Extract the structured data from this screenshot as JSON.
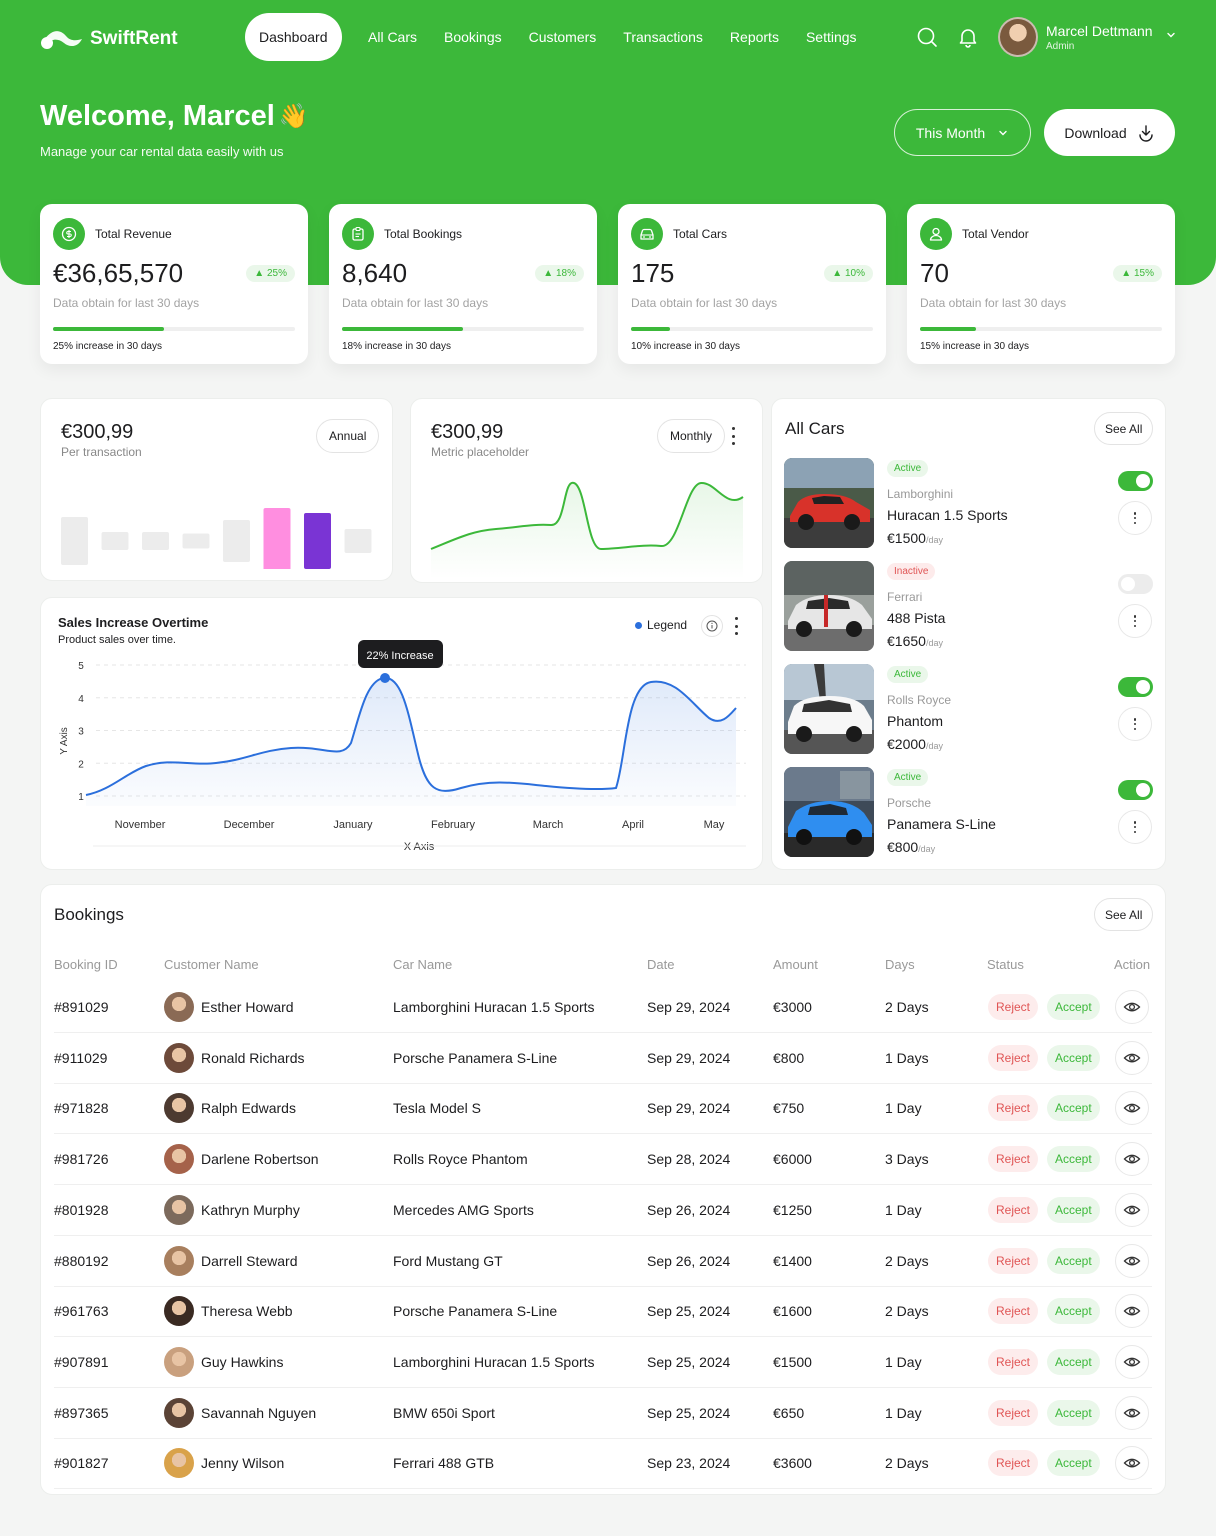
{
  "brand": {
    "name": "SwiftRent"
  },
  "nav": {
    "items": [
      {
        "label": "Dashboard",
        "active": true
      },
      {
        "label": "All Cars"
      },
      {
        "label": "Bookings"
      },
      {
        "label": "Customers"
      },
      {
        "label": "Transactions"
      },
      {
        "label": "Reports"
      },
      {
        "label": "Settings"
      }
    ],
    "icons": [
      "search-icon",
      "bell-icon"
    ]
  },
  "user": {
    "name": "Marcel Dettmann",
    "role": "Admin"
  },
  "welcome": {
    "title": "Welcome, Marcel",
    "emoji": "👋",
    "subtitle": "Manage your car rental data easily with us"
  },
  "actions": {
    "period": "This Month",
    "download": "Download"
  },
  "stats": [
    {
      "label": "Total Revenue",
      "value": "€36,65,570",
      "badge": "25%",
      "sub": "Data obtain for last 30 days",
      "progress": 0.46,
      "footer": "25% increase in 30 days",
      "icon": "dollar-icon"
    },
    {
      "label": "Total Bookings",
      "value": "8,640",
      "badge": "18%",
      "sub": "Data obtain for last 30 days",
      "progress": 0.5,
      "footer": "18% increase in 30 days",
      "icon": "clipboard-icon"
    },
    {
      "label": "Total Cars",
      "value": "175",
      "badge": "10%",
      "sub": "Data obtain for last 30 days",
      "progress": 0.16,
      "footer": "10% increase in 30 days",
      "icon": "car-icon"
    },
    {
      "label": "Total Vendor",
      "value": "70",
      "badge": "15%",
      "sub": "Data obtain for last 30 days",
      "progress": 0.23,
      "footer": "15% increase in 30 days",
      "icon": "user-icon"
    }
  ],
  "mini1": {
    "value": "€300,99",
    "sub": "Per transaction",
    "period": "Annual",
    "bars": [
      {
        "v": 0.48,
        "color": "#ececec"
      },
      {
        "v": 0.18,
        "color": "#ececec"
      },
      {
        "v": 0.18,
        "color": "#ececec"
      },
      {
        "v": 0.15,
        "color": "#ececec"
      },
      {
        "v": 0.42,
        "color": "#ececec"
      },
      {
        "v": 0.82,
        "color": "#ff8ee0"
      },
      {
        "v": 0.56,
        "color": "#7a34d4"
      },
      {
        "v": 0.24,
        "color": "#ececec"
      }
    ]
  },
  "mini2": {
    "value": "€300,99",
    "sub": "Metric placeholder",
    "period": "Monthly"
  },
  "sales": {
    "title": "Sales Increase Overtime",
    "subtitle": "Product sales over time.",
    "legend": "Legend",
    "tooltip": "22% Increase",
    "chart_data": {
      "type": "area",
      "title": "Sales Increase Overtime",
      "xlabel": "X Axis",
      "ylabel": "Y Axis",
      "categories": [
        "November",
        "December",
        "January",
        "February",
        "March",
        "April",
        "May"
      ],
      "y_ticks": [
        5,
        4,
        3,
        2,
        1
      ],
      "ylim": [
        1,
        5
      ],
      "series_color": "#2b6fdc",
      "highlight": {
        "category": "January",
        "value": 4.6,
        "label": "22% Increase"
      }
    }
  },
  "cars": {
    "title": "All Cars",
    "see_all": "See All",
    "items": [
      {
        "status": "Active",
        "active": true,
        "brand": "Lamborghini",
        "model": "Huracan 1.5 Sports",
        "price": "€1500",
        "unit": "/day",
        "color": "#d8322a"
      },
      {
        "status": "Inactive",
        "active": false,
        "brand": "Ferrari",
        "model": "488 Pista",
        "price": "€1650",
        "unit": "/day",
        "color": "#d9d9d9"
      },
      {
        "status": "Active",
        "active": true,
        "brand": "Rolls Royce",
        "model": "Phantom",
        "price": "€2000",
        "unit": "/day",
        "color": "#f4f4f4"
      },
      {
        "status": "Active",
        "active": true,
        "brand": "Porsche",
        "model": "Panamera S-Line",
        "price": "€800",
        "unit": "/day",
        "color": "#2f8ef0"
      }
    ]
  },
  "bookings": {
    "title": "Bookings",
    "see_all": "See All",
    "columns": [
      "Booking ID",
      "Customer Name",
      "Car Name",
      "Date",
      "Amount",
      "Days",
      "Status",
      "Action"
    ],
    "reject": "Reject",
    "accept": "Accept",
    "rows": [
      {
        "id": "#891029",
        "customer": "Esther Howard",
        "car": "Lamborghini Huracan 1.5 Sports",
        "date": "Sep 29, 2024",
        "amount": "€3000",
        "days": "2 Days"
      },
      {
        "id": "#911029",
        "customer": "Ronald Richards",
        "car": "Porsche Panamera S-Line",
        "date": "Sep 29, 2024",
        "amount": "€800",
        "days": "1 Days"
      },
      {
        "id": "#971828",
        "customer": "Ralph Edwards",
        "car": "Tesla Model S",
        "date": "Sep 29, 2024",
        "amount": "€750",
        "days": "1 Day"
      },
      {
        "id": "#981726",
        "customer": "Darlene Robertson",
        "car": "Rolls Royce Phantom",
        "date": "Sep 28, 2024",
        "amount": "€6000",
        "days": "3 Days"
      },
      {
        "id": "#801928",
        "customer": "Kathryn Murphy",
        "car": "Mercedes AMG Sports",
        "date": "Sep 26, 2024",
        "amount": "€1250",
        "days": "1 Day"
      },
      {
        "id": "#880192",
        "customer": "Darrell Steward",
        "car": "Ford Mustang GT",
        "date": "Sep 26, 2024",
        "amount": "€1400",
        "days": "2 Days"
      },
      {
        "id": "#961763",
        "customer": "Theresa Webb",
        "car": "Porsche Panamera S-Line",
        "date": "Sep 25, 2024",
        "amount": "€1600",
        "days": "2 Days"
      },
      {
        "id": "#907891",
        "customer": "Guy Hawkins",
        "car": "Lamborghini Huracan 1.5 Sports",
        "date": "Sep 25, 2024",
        "amount": "€1500",
        "days": "1 Day"
      },
      {
        "id": "#897365",
        "customer": "Savannah Nguyen",
        "car": "BMW 650i Sport",
        "date": "Sep 25, 2024",
        "amount": "€650",
        "days": "1 Day"
      },
      {
        "id": "#901827",
        "customer": "Jenny Wilson",
        "car": "Ferrari 488 GTB",
        "date": "Sep 23, 2024",
        "amount": "€3600",
        "days": "2 Days"
      }
    ]
  },
  "colors": {
    "brand": "#3cb83a",
    "accent": "#2b6fdc",
    "danger": "#e05555"
  }
}
